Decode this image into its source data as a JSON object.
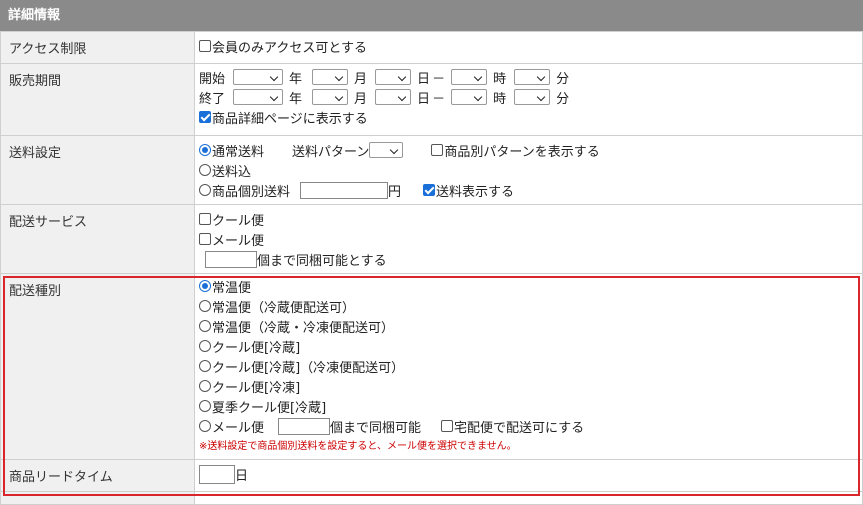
{
  "header": {
    "title": "詳細情報"
  },
  "access": {
    "label": "アクセス制限",
    "members_only": "会員のみアクセス可とする"
  },
  "period": {
    "label": "販売期間",
    "start": "開始",
    "end": "終了",
    "year": "年",
    "month": "月",
    "day": "日",
    "dash": "－",
    "hour": "時",
    "minute": "分",
    "show_on_detail": "商品詳細ページに表示する"
  },
  "shipping_fee": {
    "label": "送料設定",
    "normal": "通常送料",
    "pattern_label": "送料パターン",
    "show_pattern": "商品別パターンを表示する",
    "included": "送料込",
    "individual": "商品個別送料",
    "yen": "円",
    "show_fee": "送料表示する"
  },
  "delivery_service": {
    "label": "配送サービス",
    "cool": "クール便",
    "mail": "メール便",
    "bundle_suffix": "個まで同梱可能とする"
  },
  "delivery_type": {
    "label": "配送種別",
    "options": [
      "常温便",
      "常温便（冷蔵便配送可）",
      "常温便（冷蔵・冷凍便配送可）",
      "クール便[冷蔵]",
      "クール便[冷蔵]（冷凍便配送可）",
      "クール便[冷凍]",
      "夏季クール便[冷蔵]"
    ],
    "mail": "メール便",
    "mail_bundle": "個まで同梱可能",
    "takuhai": "宅配便で配送可にする",
    "note": "※送料設定で商品個別送料を設定すると、メール便を選択できません。"
  },
  "lead_time": {
    "label": "商品リードタイム",
    "unit": "日"
  },
  "colors": {
    "header_bg": "#8a8a8a",
    "highlight": "#d9262b",
    "accent": "#1a6fd8",
    "note": "#cc0000"
  }
}
